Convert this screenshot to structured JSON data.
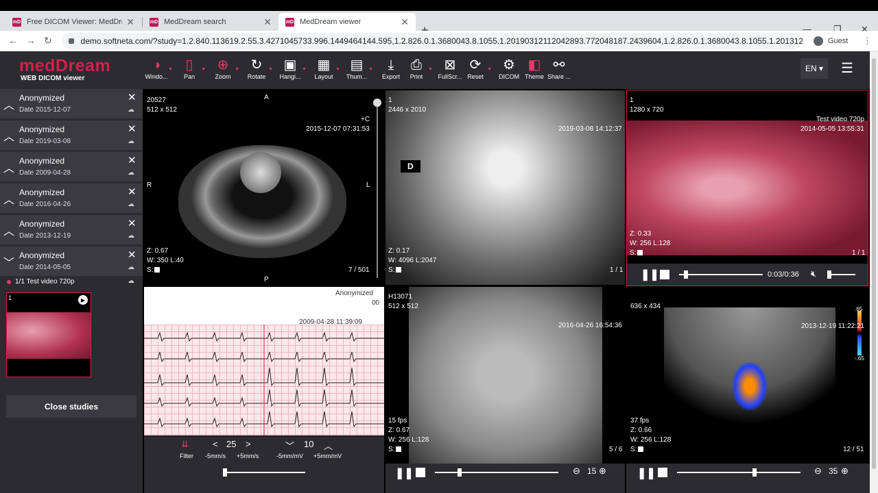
{
  "browser": {
    "tabs": [
      {
        "title": "Free DICOM Viewer: MedDream"
      },
      {
        "title": "MedDream search"
      },
      {
        "title": "MedDream viewer"
      }
    ],
    "url": "demo.softneta.com/?study=1.2.840.113619.2.55.3.4271045733.996.1449464144.595,1.2.826.0.1.3680043.8.1055.1.20190312112042893.772048187.2439604,1.2.826.0.1.3680043.8.1055.1.20131230165647...",
    "profile": "Guest"
  },
  "app": {
    "logo": "medDream",
    "logo_sub": "WEB DICOM viewer",
    "toolbar": [
      {
        "label": "Windo...",
        "icon": "window-level-icon"
      },
      {
        "label": "Pan",
        "icon": "pan-icon"
      },
      {
        "label": "Zoom",
        "icon": "zoom-icon"
      },
      {
        "label": "Rotate",
        "icon": "rotate-icon"
      },
      {
        "label": "Hangi...",
        "icon": "hanging-protocol-icon"
      },
      {
        "label": "Layout",
        "icon": "layout-icon"
      },
      {
        "label": "Thum...",
        "icon": "thumbnails-icon"
      },
      {
        "label": "Export",
        "icon": "export-icon"
      },
      {
        "label": "Print",
        "icon": "print-icon"
      },
      {
        "label": "FullScr...",
        "icon": "fullscreen-icon"
      },
      {
        "label": "Reset",
        "icon": "reset-icon"
      },
      {
        "label": "DICOM",
        "icon": "dicom-icon"
      },
      {
        "label": "Theme",
        "icon": "theme-icon"
      },
      {
        "label": "Share ...",
        "icon": "share-icon"
      }
    ],
    "language": "EN"
  },
  "sidebar": {
    "studies": [
      {
        "name": "Anonymized",
        "date": "Date 2015-12-07"
      },
      {
        "name": "Anonymized",
        "date": "Date 2019-03-08"
      },
      {
        "name": "Anonymized",
        "date": "Date 2009-04-28"
      },
      {
        "name": "Anonymized",
        "date": "Date 2016-04-26"
      },
      {
        "name": "Anonymized",
        "date": "Date 2013-12-19"
      },
      {
        "name": "Anonymized",
        "date": "Date 2014-05-05"
      }
    ],
    "series_label": "1/1 Test video 720p",
    "thumb_num": "1",
    "close_label": "Close studies"
  },
  "viewports": {
    "ct": {
      "id": "20527",
      "size": "512 x 512",
      "datetime": "2015-12-07 07:31:53",
      "zoom": "Z: 0.67",
      "wl": "W: 350 L:40",
      "s": "S:",
      "frame": "7 / 501",
      "top": "A",
      "left": "R",
      "right": "L",
      "bottom": "P",
      "c": "+C"
    },
    "xray": {
      "id": "1",
      "size": "2446 x 2010",
      "datetime": "2019-03-08 14:12:37",
      "zoom": "Z: 0.17",
      "wl": "W: 4096 L:2047",
      "s": "S:",
      "frame": "1 / 1",
      "marker": "D"
    },
    "video": {
      "id": "1",
      "size": "1280 x 720",
      "title": "Test video 720p",
      "datetime": "2014-05-05 13:55:31",
      "zoom": "Z: 0.33",
      "wl": "W: 256 L:128",
      "s": "S:",
      "frame": "1 / 1",
      "time": "0:03/0:36",
      "progress": 0.08,
      "volume": 0.05
    },
    "ecg": {
      "name": "Anonymized",
      "num": "00",
      "datetime": "2009-04-28 11:39:09",
      "speed": "25",
      "gain": "10",
      "filter": "Filter",
      "speed_minus": "-5mm/s",
      "speed_plus": "+5mm/s",
      "gain_minus": "-5mm/mV",
      "gain_plus": "+5mm/mV"
    },
    "angio": {
      "id": "H13071",
      "size": "512 x 512",
      "datetime": "2016-04-26 16:54:36",
      "fps": "15 fps",
      "zoom": "Z: 0.67",
      "wl": "W: 256 L:128",
      "s": "S:",
      "frame": "5 / 6",
      "speed": "15",
      "progress": 0.2
    },
    "echo": {
      "size": "636 x 434",
      "datetime": "2013-12-19 11:22:21",
      "fps": "37 fps",
      "zoom": "Z: 0.66",
      "wl": "W: 256 L:128",
      "s": "S:",
      "frame": "12 / 51",
      "speed": "35",
      "progress": 0.63,
      "scale_top": ".65",
      "scale_bottom": "-.65"
    }
  }
}
